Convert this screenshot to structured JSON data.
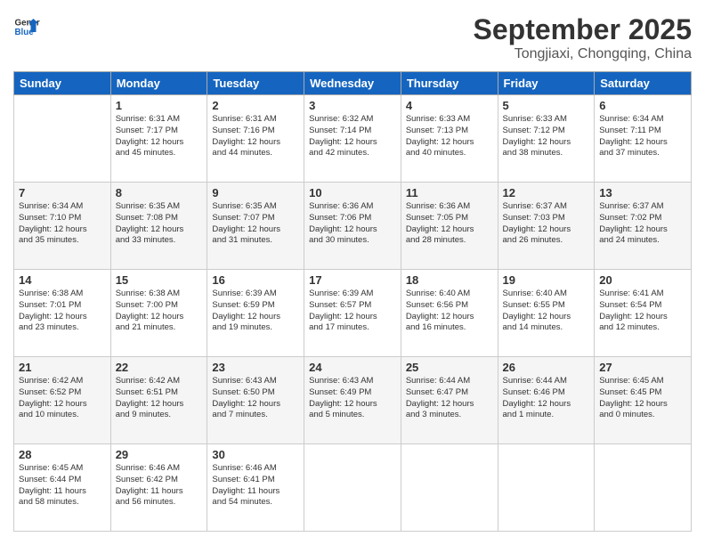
{
  "header": {
    "logo_line1": "General",
    "logo_line2": "Blue",
    "month": "September 2025",
    "location": "Tongjiaxi, Chongqing, China"
  },
  "weekdays": [
    "Sunday",
    "Monday",
    "Tuesday",
    "Wednesday",
    "Thursday",
    "Friday",
    "Saturday"
  ],
  "weeks": [
    [
      {
        "day": "",
        "info": ""
      },
      {
        "day": "1",
        "info": "Sunrise: 6:31 AM\nSunset: 7:17 PM\nDaylight: 12 hours\nand 45 minutes."
      },
      {
        "day": "2",
        "info": "Sunrise: 6:31 AM\nSunset: 7:16 PM\nDaylight: 12 hours\nand 44 minutes."
      },
      {
        "day": "3",
        "info": "Sunrise: 6:32 AM\nSunset: 7:14 PM\nDaylight: 12 hours\nand 42 minutes."
      },
      {
        "day": "4",
        "info": "Sunrise: 6:33 AM\nSunset: 7:13 PM\nDaylight: 12 hours\nand 40 minutes."
      },
      {
        "day": "5",
        "info": "Sunrise: 6:33 AM\nSunset: 7:12 PM\nDaylight: 12 hours\nand 38 minutes."
      },
      {
        "day": "6",
        "info": "Sunrise: 6:34 AM\nSunset: 7:11 PM\nDaylight: 12 hours\nand 37 minutes."
      }
    ],
    [
      {
        "day": "7",
        "info": "Sunrise: 6:34 AM\nSunset: 7:10 PM\nDaylight: 12 hours\nand 35 minutes."
      },
      {
        "day": "8",
        "info": "Sunrise: 6:35 AM\nSunset: 7:08 PM\nDaylight: 12 hours\nand 33 minutes."
      },
      {
        "day": "9",
        "info": "Sunrise: 6:35 AM\nSunset: 7:07 PM\nDaylight: 12 hours\nand 31 minutes."
      },
      {
        "day": "10",
        "info": "Sunrise: 6:36 AM\nSunset: 7:06 PM\nDaylight: 12 hours\nand 30 minutes."
      },
      {
        "day": "11",
        "info": "Sunrise: 6:36 AM\nSunset: 7:05 PM\nDaylight: 12 hours\nand 28 minutes."
      },
      {
        "day": "12",
        "info": "Sunrise: 6:37 AM\nSunset: 7:03 PM\nDaylight: 12 hours\nand 26 minutes."
      },
      {
        "day": "13",
        "info": "Sunrise: 6:37 AM\nSunset: 7:02 PM\nDaylight: 12 hours\nand 24 minutes."
      }
    ],
    [
      {
        "day": "14",
        "info": "Sunrise: 6:38 AM\nSunset: 7:01 PM\nDaylight: 12 hours\nand 23 minutes."
      },
      {
        "day": "15",
        "info": "Sunrise: 6:38 AM\nSunset: 7:00 PM\nDaylight: 12 hours\nand 21 minutes."
      },
      {
        "day": "16",
        "info": "Sunrise: 6:39 AM\nSunset: 6:59 PM\nDaylight: 12 hours\nand 19 minutes."
      },
      {
        "day": "17",
        "info": "Sunrise: 6:39 AM\nSunset: 6:57 PM\nDaylight: 12 hours\nand 17 minutes."
      },
      {
        "day": "18",
        "info": "Sunrise: 6:40 AM\nSunset: 6:56 PM\nDaylight: 12 hours\nand 16 minutes."
      },
      {
        "day": "19",
        "info": "Sunrise: 6:40 AM\nSunset: 6:55 PM\nDaylight: 12 hours\nand 14 minutes."
      },
      {
        "day": "20",
        "info": "Sunrise: 6:41 AM\nSunset: 6:54 PM\nDaylight: 12 hours\nand 12 minutes."
      }
    ],
    [
      {
        "day": "21",
        "info": "Sunrise: 6:42 AM\nSunset: 6:52 PM\nDaylight: 12 hours\nand 10 minutes."
      },
      {
        "day": "22",
        "info": "Sunrise: 6:42 AM\nSunset: 6:51 PM\nDaylight: 12 hours\nand 9 minutes."
      },
      {
        "day": "23",
        "info": "Sunrise: 6:43 AM\nSunset: 6:50 PM\nDaylight: 12 hours\nand 7 minutes."
      },
      {
        "day": "24",
        "info": "Sunrise: 6:43 AM\nSunset: 6:49 PM\nDaylight: 12 hours\nand 5 minutes."
      },
      {
        "day": "25",
        "info": "Sunrise: 6:44 AM\nSunset: 6:47 PM\nDaylight: 12 hours\nand 3 minutes."
      },
      {
        "day": "26",
        "info": "Sunrise: 6:44 AM\nSunset: 6:46 PM\nDaylight: 12 hours\nand 1 minute."
      },
      {
        "day": "27",
        "info": "Sunrise: 6:45 AM\nSunset: 6:45 PM\nDaylight: 12 hours\nand 0 minutes."
      }
    ],
    [
      {
        "day": "28",
        "info": "Sunrise: 6:45 AM\nSunset: 6:44 PM\nDaylight: 11 hours\nand 58 minutes."
      },
      {
        "day": "29",
        "info": "Sunrise: 6:46 AM\nSunset: 6:42 PM\nDaylight: 11 hours\nand 56 minutes."
      },
      {
        "day": "30",
        "info": "Sunrise: 6:46 AM\nSunset: 6:41 PM\nDaylight: 11 hours\nand 54 minutes."
      },
      {
        "day": "",
        "info": ""
      },
      {
        "day": "",
        "info": ""
      },
      {
        "day": "",
        "info": ""
      },
      {
        "day": "",
        "info": ""
      }
    ]
  ]
}
